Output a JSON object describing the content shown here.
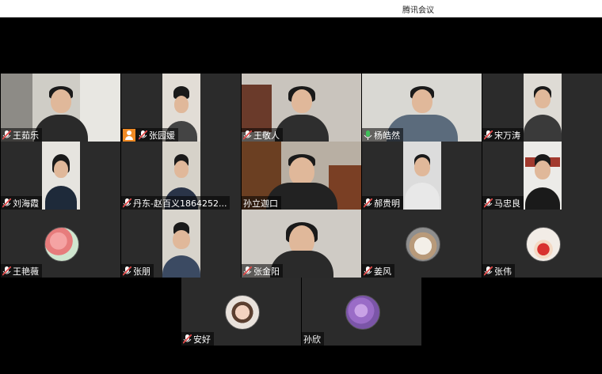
{
  "window": {
    "title": "腾讯会议"
  },
  "participants": [
    {
      "name": "王茹乐",
      "mic": "muted",
      "avatar": "camera"
    },
    {
      "name": "张园媛",
      "mic": "muted",
      "avatar": "camera",
      "badge": "user-icon"
    },
    {
      "name": "王敬人",
      "mic": "muted",
      "avatar": "camera"
    },
    {
      "name": "杨皓然",
      "mic": "speaking",
      "avatar": "camera",
      "active": true
    },
    {
      "name": "宋万涛",
      "mic": "muted",
      "avatar": "camera"
    },
    {
      "name": "刘海霞",
      "mic": "muted",
      "avatar": "camera"
    },
    {
      "name": "丹东-赵百义1864252...",
      "mic": "muted",
      "avatar": "camera"
    },
    {
      "name": "孙立迦口",
      "mic": "none",
      "avatar": "camera"
    },
    {
      "name": "郝贵明",
      "mic": "muted",
      "avatar": "camera"
    },
    {
      "name": "马忠良",
      "mic": "muted",
      "avatar": "camera"
    },
    {
      "name": "王艳薇",
      "mic": "muted",
      "avatar": "flowers"
    },
    {
      "name": "张朋",
      "mic": "muted",
      "avatar": "camera"
    },
    {
      "name": "张金阳",
      "mic": "muted",
      "avatar": "camera"
    },
    {
      "name": "姜风",
      "mic": "muted",
      "avatar": "puppy"
    },
    {
      "name": "张伟",
      "mic": "muted",
      "avatar": "child"
    },
    {
      "name": "安好",
      "mic": "muted",
      "avatar": "baby"
    },
    {
      "name": "孙欣",
      "mic": "none",
      "avatar": "purple-flowers"
    }
  ],
  "colors": {
    "active_border": "#3fa24a",
    "mute_icon": "#e24a4a",
    "speaking_icon": "#3fbf5a",
    "user_badge": "#f08a24"
  }
}
